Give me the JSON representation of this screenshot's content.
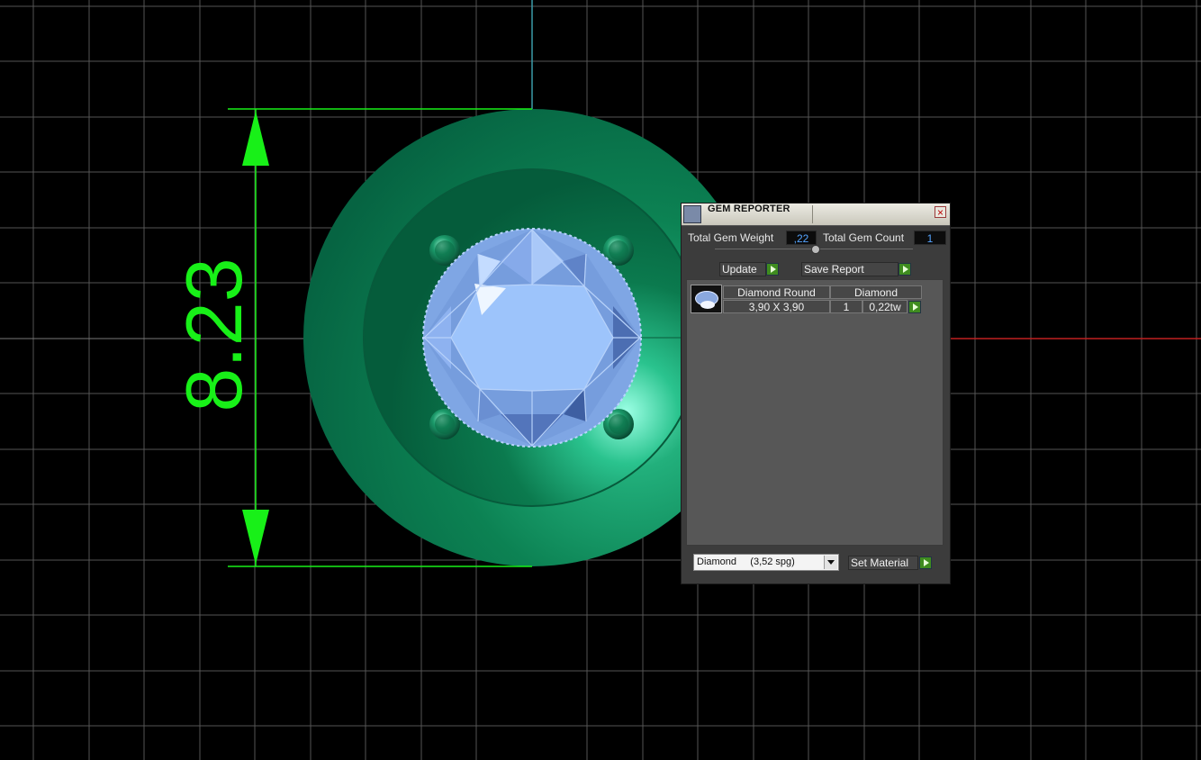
{
  "viewport": {
    "dimension_label": "8.23",
    "colors": {
      "grid": "#5a5a5a",
      "dimension": "#18f018",
      "metal": "#0e8a58",
      "gem": "#8fb8f2",
      "axis_x": "#c02020",
      "axis_y": "#3a9aa8"
    }
  },
  "gem_reporter": {
    "title": "GEM REPORTER",
    "close_label": "×",
    "total_gem_weight_label": "Total Gem Weight",
    "total_gem_weight_value": ",22",
    "total_gem_count_label": "Total Gem Count",
    "total_gem_count_value": "1",
    "update_label": "Update",
    "save_report_label": "Save Report",
    "gem_list": [
      {
        "name": "Diamond Round",
        "material": "Diamond",
        "size": "3,90 X 3,90",
        "count": "1",
        "weight": "0,22tw",
        "icon": "round-gem-icon"
      }
    ],
    "material_select_value": "Diamond     (3,52 spg)",
    "set_material_label": "Set Material",
    "accent_color": "#3f8c1f"
  }
}
